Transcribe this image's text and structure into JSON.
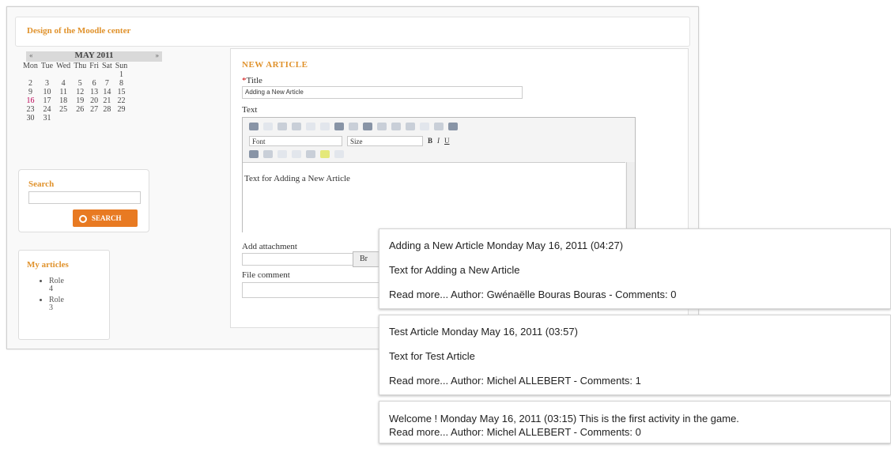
{
  "page": {
    "title": "Design of the Moodle center"
  },
  "calendar": {
    "prev": "«",
    "next": "»",
    "month": "MAY 2011",
    "weekdays": [
      "Mon",
      "Tue",
      "Wed",
      "Thu",
      "Fri",
      "Sat",
      "Sun"
    ],
    "weeks": [
      [
        "",
        "",
        "",
        "",
        "",
        "",
        "1"
      ],
      [
        "2",
        "3",
        "4",
        "5",
        "6",
        "7",
        "8"
      ],
      [
        "9",
        "10",
        "11",
        "12",
        "13",
        "14",
        "15"
      ],
      [
        "16",
        "17",
        "18",
        "19",
        "20",
        "21",
        "22"
      ],
      [
        "23",
        "24",
        "25",
        "26",
        "27",
        "28",
        "29"
      ],
      [
        "30",
        "31",
        "",
        "",
        "",
        "",
        ""
      ]
    ],
    "selected_day": "16"
  },
  "search": {
    "label": "Search",
    "button": "SEARCH"
  },
  "my_articles": {
    "label": "My articles",
    "items": [
      "Role 4",
      "Role 3"
    ]
  },
  "new_article": {
    "heading": "NEW ARTICLE",
    "title_required_mark": "*",
    "title_label": "Title",
    "title_value": "Adding a New Article",
    "text_label": "Text",
    "font_select": "Font",
    "size_select": "Size",
    "bold": "B",
    "italic": "I",
    "underline": "U",
    "body_text": "Text for Adding a New Article",
    "attachment_label": "Add attachment",
    "browse_button": "Br",
    "file_comment_label": "File comment"
  },
  "feed": [
    {
      "line1": "Adding a New Article Monday May 16, 2011 (04:27)",
      "line2": "Text for Adding a New Article",
      "line3": "Read more... Author: Gwénaëlle Bouras Bouras - Comments: 0"
    },
    {
      "line1": "Test Article Monday May 16, 2011 (03:57)",
      "line2": "Text for Test Article",
      "line3": "Read more... Author: Michel ALLEBERT - Comments: 1"
    },
    {
      "line1": "Welcome ! Monday May 16, 2011 (03:15) This is the first activity in the game.",
      "line3": "Read more... Author: Michel ALLEBERT - Comments: 0"
    }
  ]
}
